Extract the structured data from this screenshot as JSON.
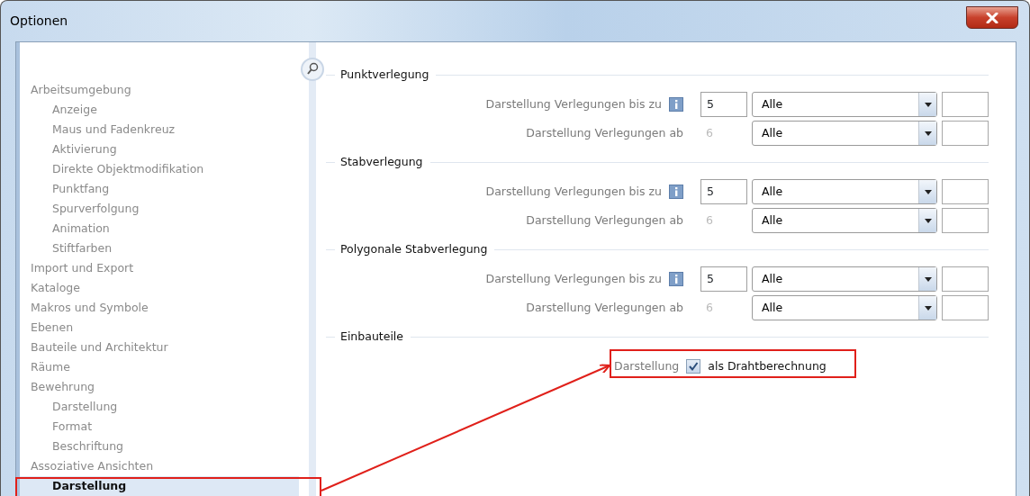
{
  "window": {
    "title": "Optionen"
  },
  "sidebar": {
    "items": [
      {
        "label": "Arbeitsumgebung",
        "selected": false,
        "children": [
          {
            "label": "Anzeige",
            "selected": false
          },
          {
            "label": "Maus und Fadenkreuz",
            "selected": false
          },
          {
            "label": "Aktivierung",
            "selected": false
          },
          {
            "label": "Direkte Objektmodifikation",
            "selected": false
          },
          {
            "label": "Punktfang",
            "selected": false
          },
          {
            "label": "Spurverfolgung",
            "selected": false
          },
          {
            "label": "Animation",
            "selected": false
          },
          {
            "label": "Stiftfarben",
            "selected": false
          }
        ]
      },
      {
        "label": "Import und Export",
        "selected": false
      },
      {
        "label": "Kataloge",
        "selected": false
      },
      {
        "label": "Makros und Symbole",
        "selected": false
      },
      {
        "label": "Ebenen",
        "selected": false
      },
      {
        "label": "Bauteile und Architektur",
        "selected": false
      },
      {
        "label": "Räume",
        "selected": false
      },
      {
        "label": "Bewehrung",
        "selected": false,
        "children": [
          {
            "label": "Darstellung",
            "selected": false
          },
          {
            "label": "Format",
            "selected": false
          },
          {
            "label": "Beschriftung",
            "selected": false
          }
        ]
      },
      {
        "label": "Assoziative Ansichten",
        "selected": false,
        "children": [
          {
            "label": "Darstellung",
            "selected": true
          }
        ]
      }
    ]
  },
  "sections": [
    {
      "title": "Punktverlegung",
      "rows": [
        {
          "kind": "input",
          "label": "Darstellung Verlegungen bis zu",
          "info": true,
          "value": "5",
          "dropdown": "Alle"
        },
        {
          "kind": "readonly",
          "label": "Darstellung Verlegungen ab",
          "info": false,
          "value": "6",
          "dropdown": "Alle"
        }
      ]
    },
    {
      "title": "Stabverlegung",
      "rows": [
        {
          "kind": "input",
          "label": "Darstellung Verlegungen bis zu",
          "info": true,
          "value": "5",
          "dropdown": "Alle"
        },
        {
          "kind": "readonly",
          "label": "Darstellung Verlegungen ab",
          "info": false,
          "value": "6",
          "dropdown": "Alle"
        }
      ]
    },
    {
      "title": "Polygonale Stabverlegung",
      "rows": [
        {
          "kind": "input",
          "label": "Darstellung Verlegungen bis zu",
          "info": true,
          "value": "5",
          "dropdown": "Alle"
        },
        {
          "kind": "readonly",
          "label": "Darstellung Verlegungen ab",
          "info": false,
          "value": "6",
          "dropdown": "Alle"
        }
      ]
    },
    {
      "title": "Einbauteile",
      "rows": [
        {
          "kind": "checkbox",
          "label": "Darstellung",
          "checked": true,
          "text": "als Drahtberechnung"
        }
      ]
    }
  ]
}
